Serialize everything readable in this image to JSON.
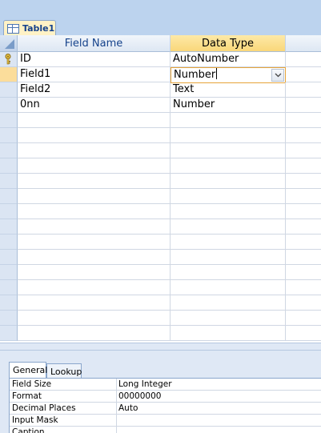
{
  "tab": {
    "label": "Table1"
  },
  "grid": {
    "columns": [
      "Field Name",
      "Data Type"
    ],
    "rows": [
      {
        "field_name": "ID",
        "data_type": "AutoNumber",
        "primary_key": true
      },
      {
        "field_name": "Field1",
        "data_type": "Number",
        "active": true
      },
      {
        "field_name": "Field2",
        "data_type": "Text"
      },
      {
        "field_name": "0nn",
        "data_type": "Number"
      }
    ]
  },
  "properties": {
    "tabs": [
      "General",
      "Lookup"
    ],
    "active_tab": "General",
    "rows": [
      {
        "name": "Field Size",
        "value": "Long Integer"
      },
      {
        "name": "Format",
        "value": "00000000"
      },
      {
        "name": "Decimal Places",
        "value": "Auto"
      },
      {
        "name": "Input Mask",
        "value": ""
      },
      {
        "name": "Caption",
        "value": ""
      }
    ]
  },
  "colors": {
    "accent": "#15428b",
    "selection": "#fbdd9b",
    "active_border": "#e6a43a"
  }
}
